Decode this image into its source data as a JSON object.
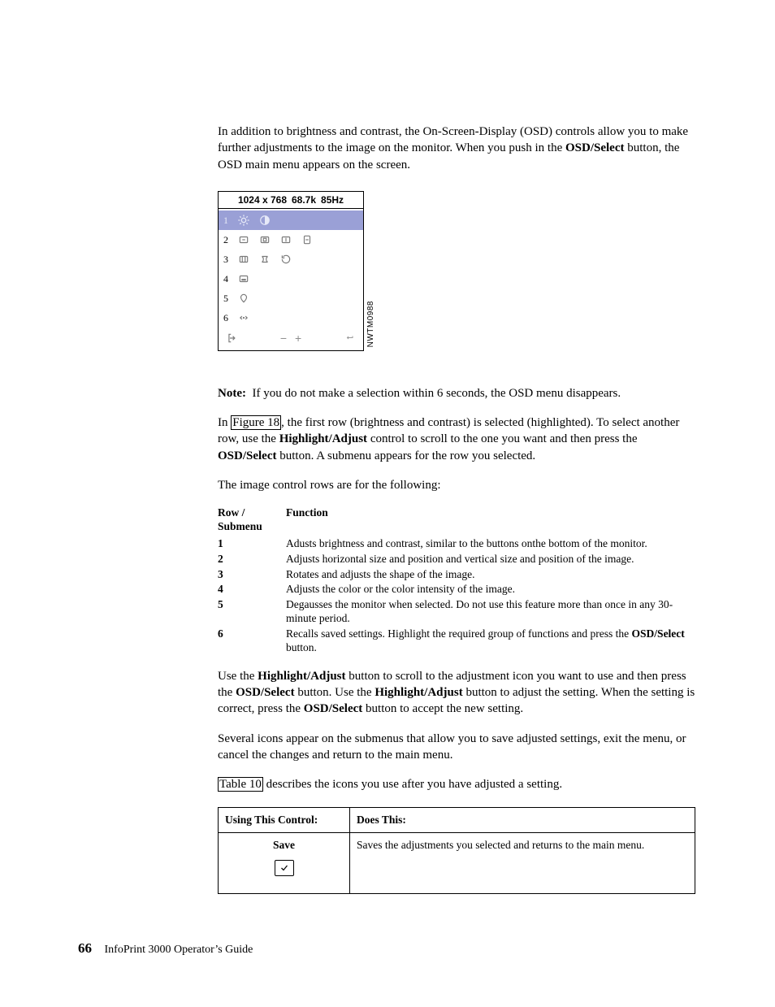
{
  "intro": {
    "p1a": "In addition to brightness and contrast, the On-Screen-Display (OSD) controls allow you to make further adjustments to the image on the monitor. When you push in the ",
    "osd_select": "OSD/Select",
    "p1b": " button, the OSD main menu appears on the screen."
  },
  "osd": {
    "res": "1024 x 768",
    "freq": "68.7k",
    "hz": "85Hz",
    "sidelabel": "NWTM0988",
    "rows": [
      "1",
      "2",
      "3",
      "4",
      "5",
      "6"
    ]
  },
  "note": {
    "label": "Note:",
    "text": "If you do not make a selection within 6 seconds, the OSD menu disappears."
  },
  "para2": {
    "a": "In ",
    "link": "Figure 18",
    "b": ", the first row (brightness and contrast) is selected (highlighted). To select another row, use the ",
    "hi_adj": "Highlight/Adjust",
    "c": " control to scroll to the one you want and then press the ",
    "osd_sel": "OSD/Select",
    "d": " button. A submenu appears for the row you selected."
  },
  "para3": "The image control rows are for the following:",
  "rowtable": {
    "headA_line1": "Row /",
    "headA_line2": "Submenu",
    "headB": "Function",
    "rows": [
      {
        "n": "1",
        "t": "Adusts brightness and contrast, similar to the buttons onthe bottom of the monitor."
      },
      {
        "n": "2",
        "t": "Adjusts horizontal size and position and vertical size and position of the image."
      },
      {
        "n": "3",
        "t": "Rotates and adjusts the shape of the image."
      },
      {
        "n": "4",
        "t": "Adjusts the color or the color intensity of the image."
      },
      {
        "n": "5",
        "t": "Degausses the monitor when selected. Do not use this feature more than once in any 30-minute period."
      },
      {
        "n": "6",
        "t_a": "Recalls saved settings. Highlight the required group of functions and press the ",
        "t_bold": "OSD/Select",
        "t_b": " button."
      }
    ]
  },
  "para4": {
    "a": "Use the ",
    "hi1": "Highlight/Adjust",
    "b": " button to scroll to the adjustment icon you want to use and then press the ",
    "os1": "OSD/Select",
    "c": " button. Use the ",
    "hi2": "Highlight/Adjust",
    "d": " button to adjust the setting. When the setting is correct, press the ",
    "os2": "OSD/Select",
    "e": " button to accept the new setting."
  },
  "para5": "Several icons appear on the submenus that allow you to save adjusted settings, exit the menu, or cancel the changes and return to the main menu.",
  "para6": {
    "link": "Table 10",
    "rest": " describes the icons you use after you have adjusted a setting."
  },
  "ctable": {
    "h1": "Using This Control:",
    "h2": "Does This:",
    "r1_label": "Save",
    "r1_text": "Saves the adjustments you selected and returns to the main menu."
  },
  "footer": {
    "page": "66",
    "title": "InfoPrint 3000 Operator’s Guide"
  }
}
